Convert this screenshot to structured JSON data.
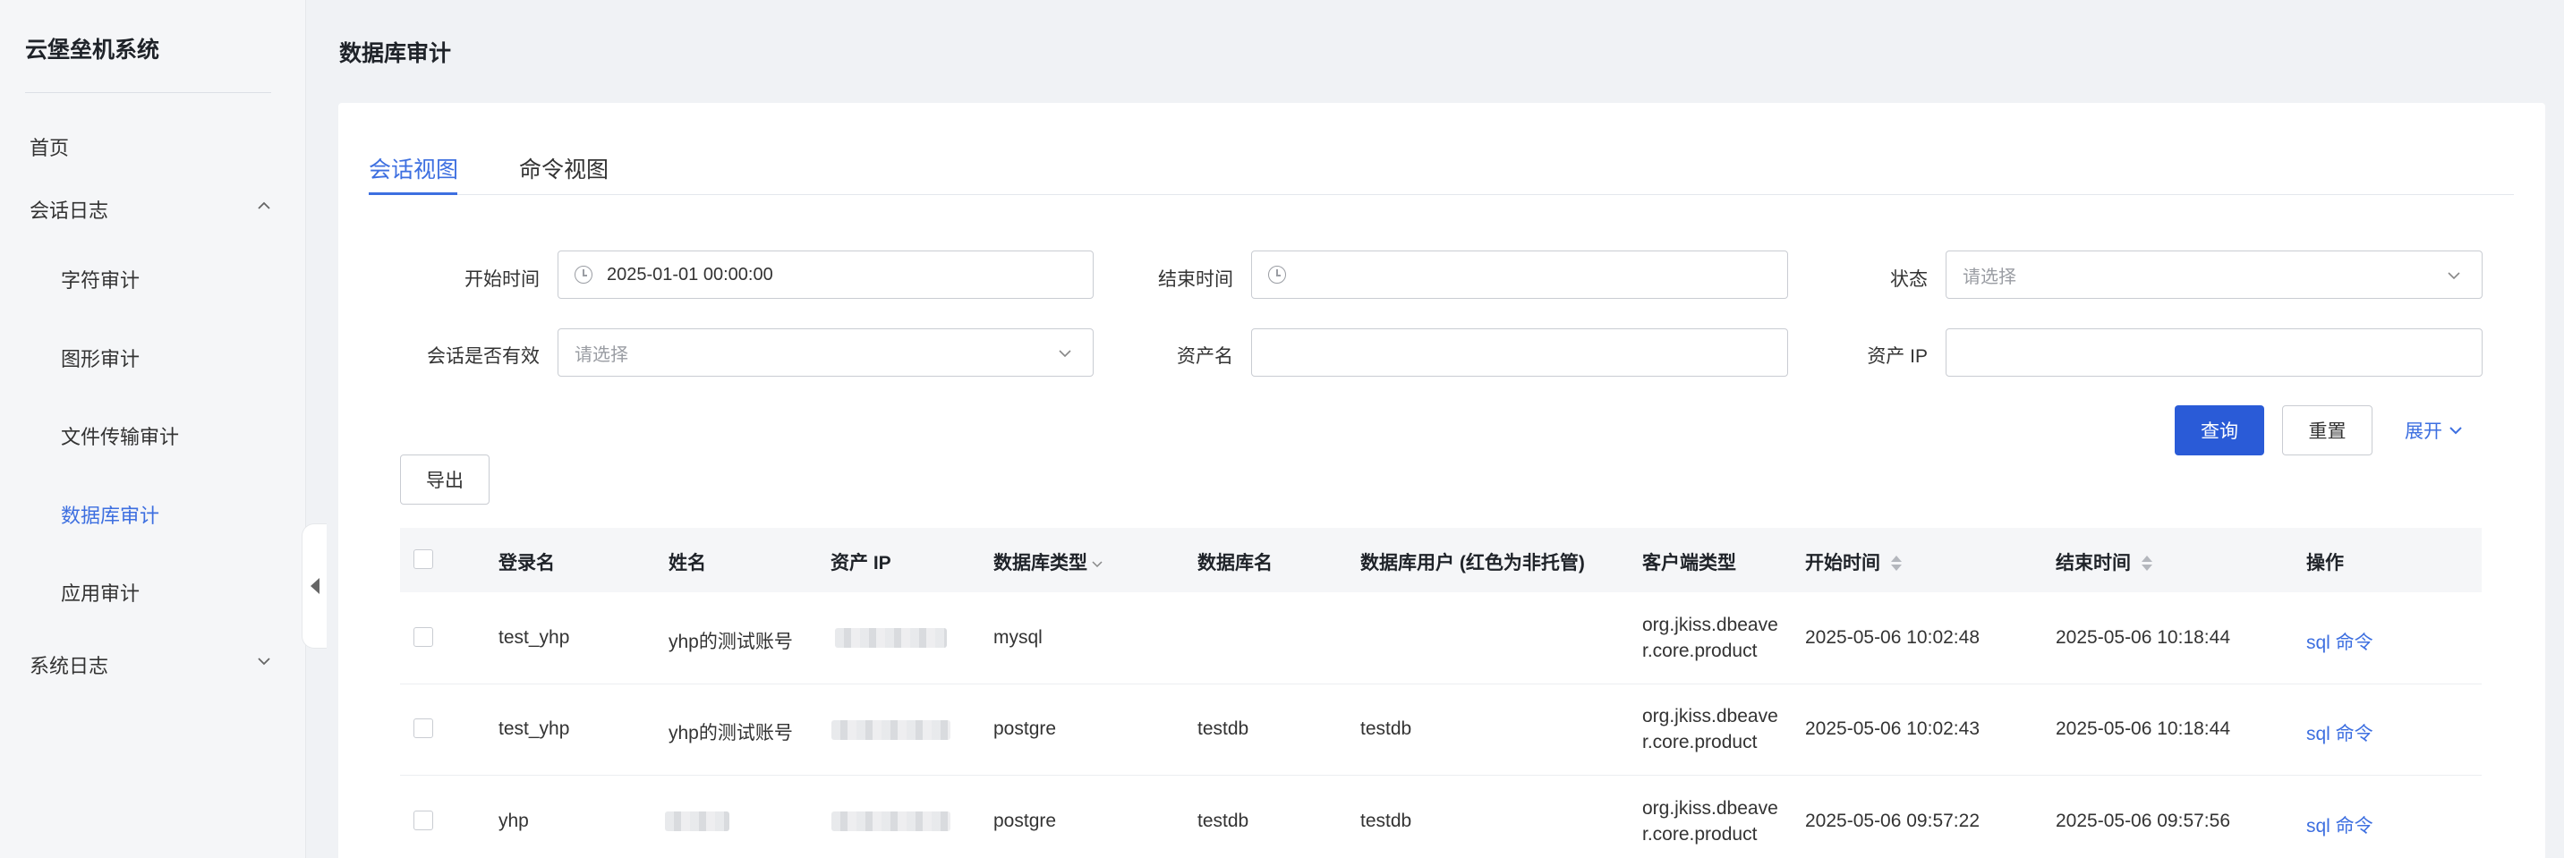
{
  "sidebar": {
    "brand": "云堡垒机系统",
    "items": [
      {
        "label": "首页"
      },
      {
        "label": "会话日志"
      },
      {
        "label": "字符审计"
      },
      {
        "label": "图形审计"
      },
      {
        "label": "文件传输审计"
      },
      {
        "label": "数据库审计"
      },
      {
        "label": "应用审计"
      },
      {
        "label": "系统日志"
      }
    ],
    "active_item": "数据库审计"
  },
  "header": {
    "title": "数据库审计"
  },
  "tabs": [
    {
      "label": "会话视图",
      "active": true
    },
    {
      "label": "命令视图",
      "active": false
    }
  ],
  "filters": {
    "start_time": {
      "label": "开始时间",
      "value": "2025-01-01 00:00:00"
    },
    "end_time": {
      "label": "结束时间",
      "value": ""
    },
    "status": {
      "label": "状态",
      "placeholder": "请选择"
    },
    "session_valid": {
      "label": "会话是否有效",
      "placeholder": "请选择"
    },
    "asset_name": {
      "label": "资产名",
      "value": ""
    },
    "asset_ip": {
      "label": "资产 IP",
      "value": ""
    }
  },
  "actions": {
    "query": "查询",
    "reset": "重置",
    "expand": "展开",
    "export": "导出"
  },
  "table": {
    "columns": [
      "登录名",
      "姓名",
      "资产 IP",
      "数据库类型",
      "数据库名",
      "数据库用户 (红色为非托管)",
      "客户端类型",
      "开始时间",
      "结束时间",
      "操作"
    ],
    "rows": [
      {
        "login": "test_yhp",
        "name": "yhp的测试账号",
        "db_type": "mysql",
        "db_name": "",
        "db_user": "",
        "client": "org.jkiss.dbeaver.core.product",
        "start": "2025-05-06 10:02:48",
        "end": "2025-05-06 10:18:44",
        "op": "sql 命令"
      },
      {
        "login": "test_yhp",
        "name": "yhp的测试账号",
        "db_type": "postgre",
        "db_name": "testdb",
        "db_user": "testdb",
        "client": "org.jkiss.dbeaver.core.product",
        "start": "2025-05-06 10:02:43",
        "end": "2025-05-06 10:18:44",
        "op": "sql 命令"
      },
      {
        "login": "yhp",
        "name": "",
        "db_type": "postgre",
        "db_name": "testdb",
        "db_user": "testdb",
        "client": "org.jkiss.dbeaver.core.product",
        "start": "2025-05-06 09:57:22",
        "end": "2025-05-06 09:57:56",
        "op": "sql 命令"
      }
    ]
  },
  "colors": {
    "primary": "#2a5bd7",
    "link": "#3d6fe0"
  }
}
